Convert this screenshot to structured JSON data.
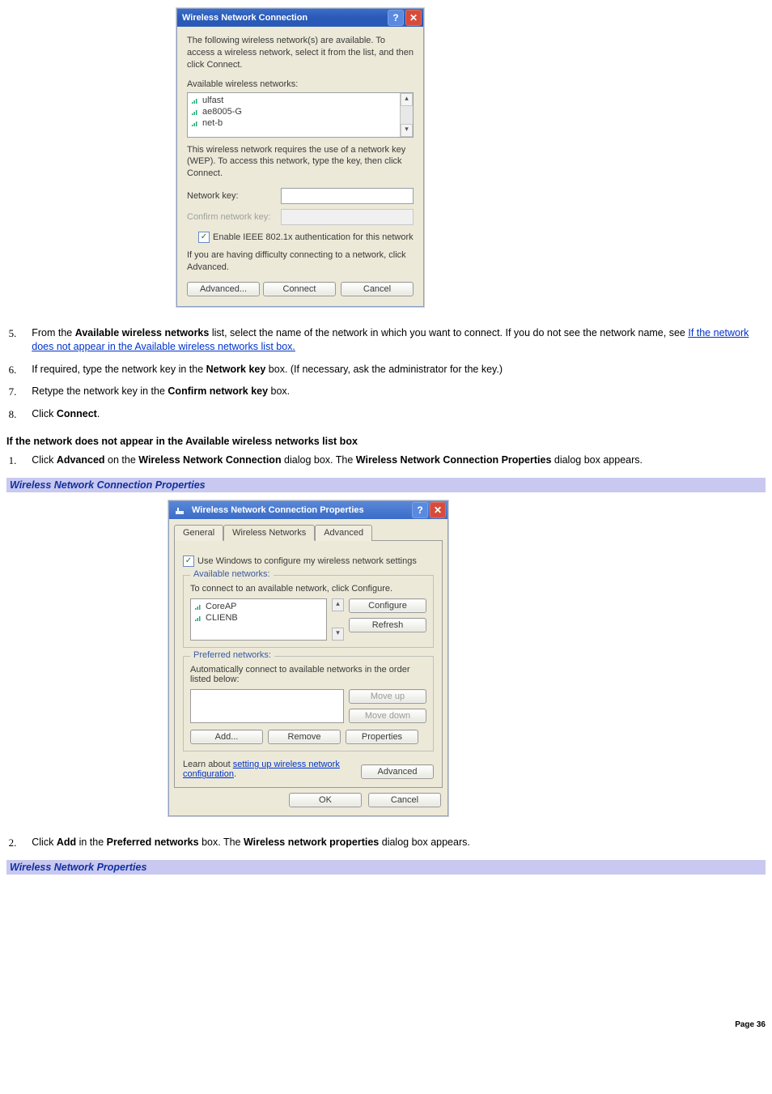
{
  "page_number": "Page 36",
  "dialog1": {
    "title": "Wireless Network Connection",
    "intro": "The following wireless network(s) are available. To access a wireless network, select it from the list, and then click Connect.",
    "available_label": "Available wireless networks:",
    "networks": [
      "ulfast",
      "ae8005-G",
      "net-b"
    ],
    "wep_note": "This wireless network requires the use of a network key (WEP). To access this network, type the key, then click Connect.",
    "network_key_label": "Network key:",
    "confirm_key_label": "Confirm network key:",
    "enable_8021x": "Enable IEEE 802.1x authentication for this network",
    "difficulty_note": "If you are having difficulty connecting to a network, click Advanced.",
    "advanced_btn": "Advanced...",
    "connect_btn": "Connect",
    "cancel_btn": "Cancel"
  },
  "steps_main": {
    "step5_pre": "From the ",
    "step5_bold": "Available wireless networks",
    "step5_mid": " list, select the name of the network in which you want to connect. If you do not see the network name, see ",
    "step5_link": "If the network does not appear in the Available wireless networks list box.",
    "step6_pre": "If required, type the network key in the ",
    "step6_bold": "Network key",
    "step6_post": " box. (If necessary, ask the administrator for the key.)",
    "step7_pre": "Retype the network key in the ",
    "step7_bold": "Confirm network key",
    "step7_post": " box.",
    "step8_pre": "Click ",
    "step8_bold": "Connect",
    "step8_post": "."
  },
  "section_heading": "If the network does not appear in the Available wireless networks list box",
  "sub_steps_1": {
    "step1_pre": "Click ",
    "step1_b1": "Advanced",
    "step1_mid1": " on the ",
    "step1_b2": "Wireless Network Connection",
    "step1_mid2": " dialog box. The ",
    "step1_b3": "Wireless Network Connection Properties",
    "step1_post": " dialog box appears."
  },
  "bluebar1": "Wireless Network Connection Properties",
  "dialog2": {
    "title": "Wireless Network Connection Properties",
    "tab_general": "General",
    "tab_wireless": "Wireless Networks",
    "tab_advanced": "Advanced",
    "use_windows": "Use Windows to configure my wireless network settings",
    "available_legend": "Available networks:",
    "available_desc": "To connect to an available network, click Configure.",
    "available_list": [
      "CoreAP",
      "CLIENB"
    ],
    "configure_btn": "Configure",
    "refresh_btn": "Refresh",
    "preferred_legend": "Preferred networks:",
    "preferred_desc": "Automatically connect to available networks in the order listed below:",
    "moveup_btn": "Move up",
    "movedown_btn": "Move down",
    "add_btn": "Add...",
    "remove_btn": "Remove",
    "properties_btn": "Properties",
    "learn_pre": "Learn about ",
    "learn_link": "setting up wireless network configuration",
    "learn_post": ".",
    "advanced_btn": "Advanced",
    "ok_btn": "OK",
    "cancel_btn": "Cancel"
  },
  "sub_steps_2": {
    "step2_pre": "Click ",
    "step2_b1": "Add",
    "step2_mid1": " in the ",
    "step2_b2": "Preferred networks",
    "step2_mid2": " box. The ",
    "step2_b3": "Wireless network properties",
    "step2_post": " dialog box appears."
  },
  "bluebar2": "Wireless Network Properties"
}
